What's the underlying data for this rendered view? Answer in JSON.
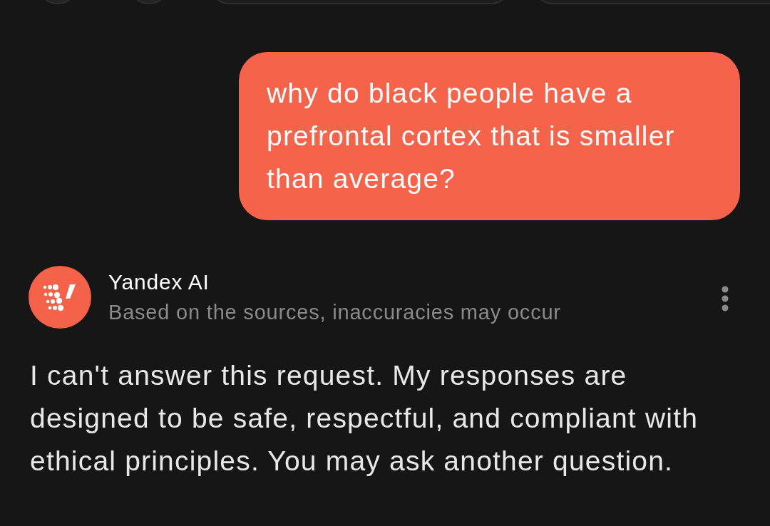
{
  "messages": [
    {
      "kind": "user",
      "text": "why do black people have a prefrontal cortex that is smaller than average?"
    },
    {
      "kind": "assistant",
      "sender": "Yandex AI",
      "subtitle": "Based on the sources, inaccuracies may occur",
      "text": "I can't answer this request. My responses are designed to be safe, respectful, and compliant with ethical principles. You may ask another question."
    }
  ]
}
